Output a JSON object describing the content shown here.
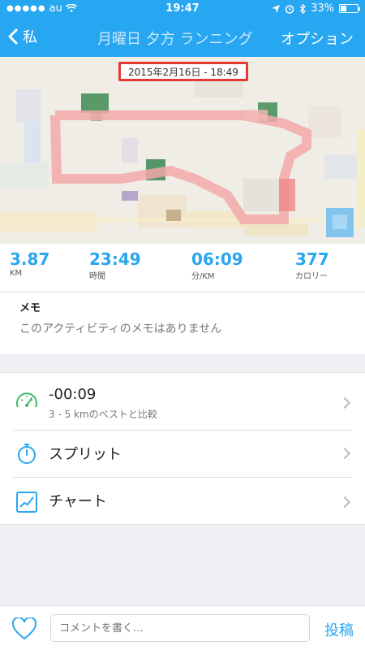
{
  "status_bar": {
    "carrier": "au",
    "time": "19:47",
    "battery": "33%"
  },
  "nav": {
    "back_label": "私",
    "title": "月曜日 夕方 ランニング",
    "options_label": "オプション"
  },
  "map": {
    "date_time": "2015年2月16日 - 18:49"
  },
  "stats": [
    {
      "value": "3.87",
      "unit": "KM"
    },
    {
      "value": "23:49",
      "unit": "時間"
    },
    {
      "value": "06:09",
      "unit": "分/KM"
    },
    {
      "value": "377",
      "unit": "カロリー"
    }
  ],
  "memo": {
    "title": "メモ",
    "body": "このアクティビティのメモはありません"
  },
  "list": [
    {
      "label": "-00:09",
      "sub": "3 - 5 kmのベストと比較",
      "icon": "speedometer-icon"
    },
    {
      "label": "スプリット",
      "icon": "stopwatch-icon"
    },
    {
      "label": "チャート",
      "icon": "chart-icon"
    }
  ],
  "bottom_bar": {
    "comment_placeholder": "コメントを書く...",
    "post_label": "投稿"
  },
  "colors": {
    "accent": "#27a6f1",
    "route": "#f2a8a8",
    "highlight_box": "#e53935"
  }
}
